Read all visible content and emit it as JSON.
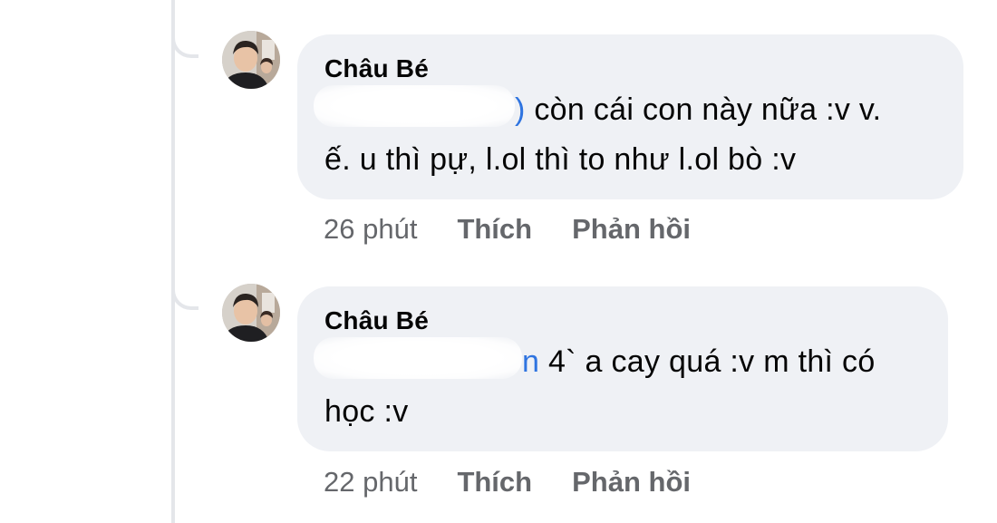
{
  "comments": [
    {
      "author": "Châu Bé",
      "mention_tail": ")",
      "line1": "còn cái con này nữa :v v.",
      "line2": "ế. u thì pự, l.ol thì to như l.ol bò :v",
      "time": "26 phút",
      "like_label": "Thích",
      "reply_label": "Phản hồi"
    },
    {
      "author": "Châu Bé",
      "mention_tail": "n",
      "line1": "4` a cay quá :v m thì có",
      "line2": "học :v",
      "time": "22 phút",
      "like_label": "Thích",
      "reply_label": "Phản hồi"
    }
  ],
  "colors": {
    "bubble": "#eff1f5",
    "text": "#050505",
    "meta": "#65676b",
    "mention": "#2f74e0",
    "thread_line": "#e4e6ea"
  },
  "icons": [
    "avatar-photo"
  ]
}
